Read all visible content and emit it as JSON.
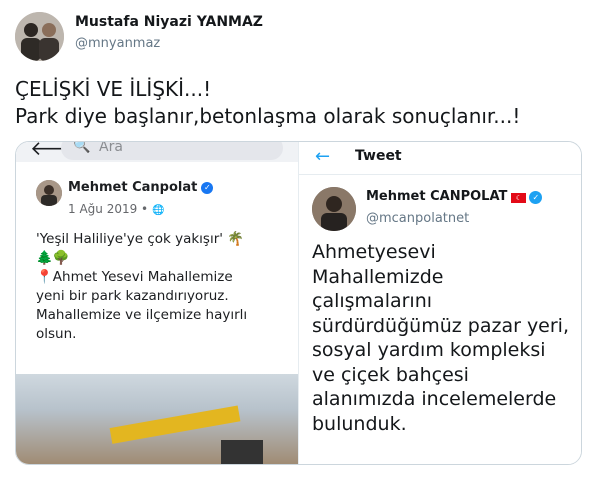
{
  "tweet": {
    "author_name": "Mustafa Niyazi YANMAZ",
    "author_handle": "@mnyanmaz",
    "text": "ÇELİŞKİ VE İLİŞKİ...!\nPark diye başlanır,betonlaşma olarak sonuçlanır...!"
  },
  "media": {
    "facebook": {
      "back_icon": "back-arrow-icon",
      "search_placeholder": "Ara",
      "author_name": "Mehmet Canpolat",
      "date": "1 Ağu 2019 •",
      "post_lines": [
        "'Yeşil Haliliye'ye çok yakışır' 🌴",
        "🌲🌳",
        "📍Ahmet Yesevi Mahallemize",
        "yeni bir park kazandırıyoruz.",
        "Mahallemize  ve ilçemize hayırlı",
        "olsun."
      ]
    },
    "twitter": {
      "header_title": "Tweet",
      "author_name": "Mehmet CANPOLAT",
      "author_handle": "@mcanpolatnet",
      "body_lines": [
        "Ahmetyesevi",
        "Mahallemizde",
        "çalışmalarını",
        "sürdürdüğümüz pazar yeri,",
        "sosyal yardım kompleksi",
        "ve çiçek bahçesi",
        "alanımızda incelemelerde",
        "bulunduk."
      ]
    }
  },
  "colors": {
    "accent": "#1da1f2",
    "facebook_blue": "#1877f2",
    "turkey_red": "#e30a17",
    "excavator_yellow": "#e3b620"
  }
}
